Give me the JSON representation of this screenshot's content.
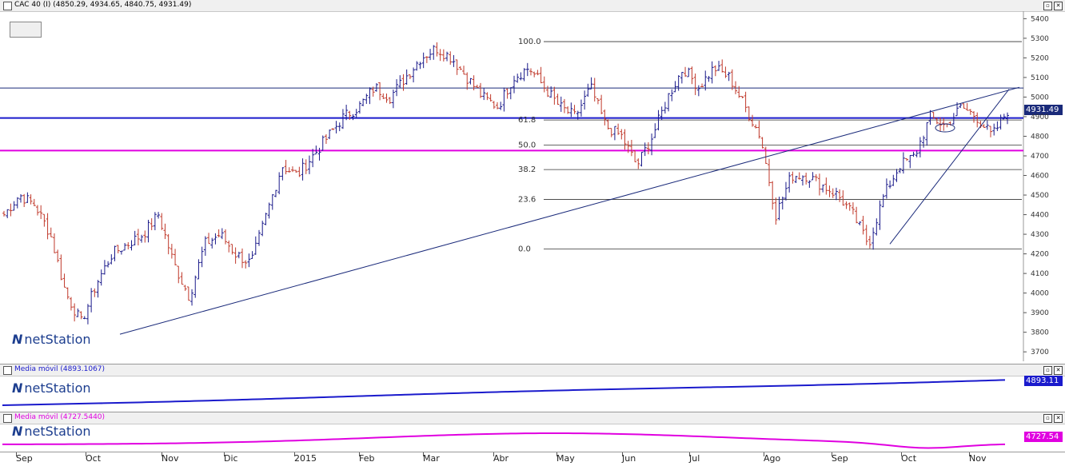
{
  "main_pane": {
    "title": "CAC 40 (I) (4850.29, 4934.65, 4840.75, 4931.49)",
    "last_price_badge": "4931.49"
  },
  "ma_blue_pane": {
    "title": "Media móvil (4893.1067)",
    "badge": "4893.11",
    "color": "#1a1acc"
  },
  "ma_pink_pane": {
    "title": "Media móvil (4727.5440)",
    "badge": "4727.54",
    "color": "#e000e0"
  },
  "brand": "netStation",
  "chart_data": {
    "type": "ohlc",
    "y_axis": {
      "ticks": [
        "5400",
        "5300",
        "5200",
        "5100",
        "5000",
        "4900",
        "4800",
        "4700",
        "4600",
        "4500",
        "4400",
        "4300",
        "4200",
        "4100",
        "4000",
        "3900",
        "3800",
        "3700"
      ],
      "range": [
        3660,
        5430
      ]
    },
    "x_axis": {
      "months": [
        "Sep",
        "Oct",
        "Nov",
        "Dic",
        "2015",
        "Feb",
        "Mar",
        "Abr",
        "May",
        "Jun",
        "Jul",
        "Ago",
        "Sep",
        "Oct",
        "Nov"
      ]
    },
    "fibonacci": {
      "levels": [
        "100.0",
        "61.8",
        "50.0",
        "38.2",
        "23.6",
        "0.0"
      ],
      "values": [
        5283,
        4883,
        4755,
        4630,
        4478,
        4225
      ]
    },
    "horizontal_lines": [
      {
        "value": 5046,
        "color": "#1a2a7a"
      },
      {
        "value": 4893,
        "color": "#1a1acc"
      },
      {
        "value": 4727,
        "color": "#e000e0"
      }
    ],
    "trendlines": [
      {
        "from": [
          "Oct",
          3790
        ],
        "to": [
          "Nov",
          5050
        ]
      },
      {
        "from": [
          "Sep",
          4250
        ],
        "to": [
          "Nov",
          5040
        ]
      }
    ],
    "close_path": [
      4400,
      4500,
      4450,
      4300,
      4000,
      3850,
      4050,
      4200,
      4250,
      4300,
      4400,
      4150,
      3980,
      4250,
      4300,
      4200,
      4150,
      4400,
      4650,
      4600,
      4700,
      4800,
      4900,
      4950,
      5050,
      5000,
      5100,
      5200,
      5250,
      5200,
      5100,
      5000,
      4950,
      5100,
      5150,
      5050,
      4950,
      4900,
      5050,
      4850,
      4800,
      4650,
      4800,
      5000,
      5150,
      5050,
      5150,
      5100,
      4950,
      4800,
      4400,
      4600,
      4600,
      4550,
      4500,
      4400,
      4250,
      4500,
      4650,
      4700,
      4900,
      4850,
      4950,
      4900,
      4800,
      4931
    ]
  }
}
